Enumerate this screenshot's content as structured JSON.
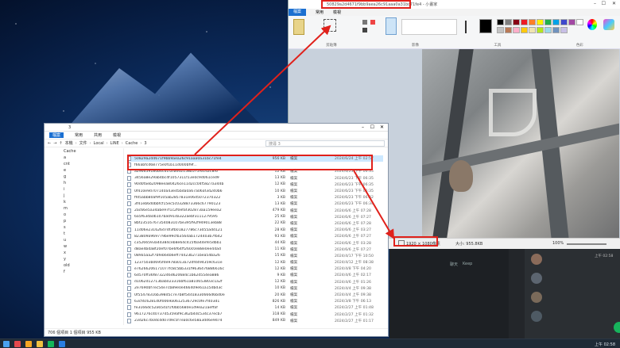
{
  "explorer": {
    "title_num": "3",
    "menu": [
      "檔案",
      "常用",
      "共用",
      "檢視"
    ],
    "breadcrumb": [
      "本機",
      "文件",
      "Local",
      "LINE",
      "Cache",
      "3"
    ],
    "search_placeholder": "搜尋 3",
    "sidebar": [
      "Cache",
      "a",
      "cnt",
      "e",
      "g",
      "h",
      "i",
      "j",
      "k",
      "m",
      "o",
      "p",
      "s",
      "t",
      "u",
      "w",
      "x",
      "y",
      "old",
      "f"
    ],
    "sidebar_selected": "3",
    "files": [
      {
        "name": "50829a2d4671f9bb9aea26c91aaa0a31bc71fe4",
        "size": "956 KB",
        "type": "檔案",
        "date": "2024/6/24 上午 02:57"
      },
      {
        "name": "f66abfcd68775e0f1b11d000bf9f...",
        "size": "",
        "type": "",
        "date": ""
      },
      {
        "name": "a296659180b4cd1f2fb0d2158b575f6142c8f6",
        "size": "12 KB",
        "type": "檔案",
        "date": "2024/6/23 下午 06:35"
      },
      {
        "name": "3456a8e29ab4bc4f1057311f13e0c9d061ced9",
        "size": "13 KB",
        "type": "檔案",
        "date": "2024/6/23 下午 06:35"
      },
      {
        "name": "90d0faeb2098eea80426ce11d2cc04f5827a344b",
        "size": "12 KB",
        "type": "檔案",
        "date": "2024/6/23 下午 06:35"
      },
      {
        "name": "0f410e9d707140a43ed5bda0a67a06af3d240b6",
        "size": "10 KB",
        "type": "檔案",
        "date": "2024/6/23 下午 06:35"
      },
      {
        "name": "ffd5abb80af9f105ab2857831e06d5072370322",
        "size": "3 KB",
        "type": "檔案",
        "date": "2024/6/23 下午 06:32"
      },
      {
        "name": "3f41eb6d0bbfcf15ec5c0328873366c67790123",
        "size": "13 KB",
        "type": "檔案",
        "date": "2024/6/23 下午 06:34"
      },
      {
        "name": "2ac66e5a34abe97f1c2f0efaf302873aa159eea2",
        "size": "479 KB",
        "type": "檔案",
        "date": "2024/6/6 上午 07:28"
      },
      {
        "name": "6a5f63da0b107ba091da322aebf3111279595",
        "size": "25 KB",
        "type": "檔案",
        "date": "2024/6/6 上午 07:27"
      },
      {
        "name": "8bf23516767354083107be395f92f949013eb88",
        "size": "22 KB",
        "type": "檔案",
        "date": "2024/6/6 上午 07:28"
      },
      {
        "name": "11d06e231626d7df3fb01827786c73d55add121",
        "size": "28 KB",
        "type": "檔案",
        "date": "2024/6/6 上午 03:27"
      },
      {
        "name": "823809a969779be99cfb3564ab1724403b7fb42",
        "size": "93 KB",
        "type": "檔案",
        "date": "2024/6/6 上午 07:27"
      },
      {
        "name": "c35266593a4d384ceb8e64c415fba44efe5dbb1",
        "size": "44 KB",
        "type": "檔案",
        "date": "2024/6/6 上午 03:28"
      },
      {
        "name": "d8ae4bda8f20ef07be6f64ff260c0e88e0ee44ad",
        "size": "11 KB",
        "type": "檔案",
        "date": "2024/6/6 上午 07:27"
      },
      {
        "name": "089a5aa2f7bfeb64b6eff74423b271bea54ba26",
        "size": "15 KB",
        "type": "檔案",
        "date": "2024/4/17 下午 10:50"
      },
      {
        "name": "1237503b0695fde978a013a72df4494359c631e",
        "size": "12 KB",
        "type": "檔案",
        "date": "2024/4/12 上午 08:38"
      },
      {
        "name": "e76266206171077fc8c5bb331f9636476886616c",
        "size": "12 KB",
        "type": "檔案",
        "date": "2024/4/8 下午 04:20"
      },
      {
        "name": "6d570ff36f8732246d620684c1b62d554ea886",
        "size": "9 KB",
        "type": "檔案",
        "date": "2024/4/6 上午 02:17"
      },
      {
        "name": "d1062d12713bab023316bf61a810653803c1a2f",
        "size": "12 KB",
        "type": "檔案",
        "date": "2024/4/6 上午 01:26"
      },
      {
        "name": "2e7690bf7ec54e7cb89e0e466409e61a15dbd3c",
        "size": "10 KB",
        "type": "檔案",
        "date": "2024/4/4 上午 09:38"
      },
      {
        "name": "0f55478316b398d5c7e7b8f54d18330666d6bd0e",
        "size": "20 KB",
        "type": "檔案",
        "date": "2024/4/4 上午 09:38"
      },
      {
        "name": "63cf4c6281d0f0069a0612536729c0fe7f403d1",
        "size": "826 KB",
        "type": "檔案",
        "date": "2024/3/8 下午 06:13"
      },
      {
        "name": "fe3166dc52a65d1f1f0bb5680e1d9ea21aeffaf",
        "size": "14 KB",
        "type": "檔案",
        "date": "2024/2/27 上午 01:48"
      },
      {
        "name": "9617276c40737d5359af9c362b4dc534c37ecb7",
        "size": "318 KB",
        "type": "檔案",
        "date": "2024/2/27 上午 01:32"
      },
      {
        "name": "23d26c7b0dcdd07d9c5f7ea0c6e58a3d46e9d74",
        "size": "849 KB",
        "type": "檔案",
        "date": "2024/2/27 上午 01:17"
      }
    ],
    "status": "706 個項目  1 個項目  955 KB"
  },
  "paint": {
    "title": "50829a2d4671f9bb9aea26c91aaa0a31bc71fe4 - 小畫家",
    "tabs": [
      "檔案",
      "常用",
      "檢視"
    ],
    "ribbon_groups": [
      "剪貼簿",
      "影像",
      "工具",
      "筆刷",
      "圖形",
      "大小",
      "色彩",
      "編輯色彩",
      "使用小畫家 3D 編輯"
    ],
    "dimensions": "1920 × 1080像素",
    "size": "大小: 955.8KB",
    "zoom": "100%",
    "palette": [
      "#000000",
      "#7f7f7f",
      "#880015",
      "#ed1c24",
      "#ff7f27",
      "#fff200",
      "#22b14c",
      "#00a2e8",
      "#3f48cc",
      "#a349a4",
      "#ffffff",
      "#c3c3c3",
      "#b97a57",
      "#ffaec9",
      "#ffc90e",
      "#efe4b0",
      "#b5e61d",
      "#99d9ea",
      "#7092be",
      "#c8bfe7"
    ]
  },
  "line": {
    "chats": [
      "聊天",
      "Keep"
    ],
    "time1": "上午 02:58"
  },
  "taskbar": {
    "time": "上午 02:58"
  },
  "colors": {
    "highlight": "#e0211b",
    "accent": "#1a6fd1"
  }
}
